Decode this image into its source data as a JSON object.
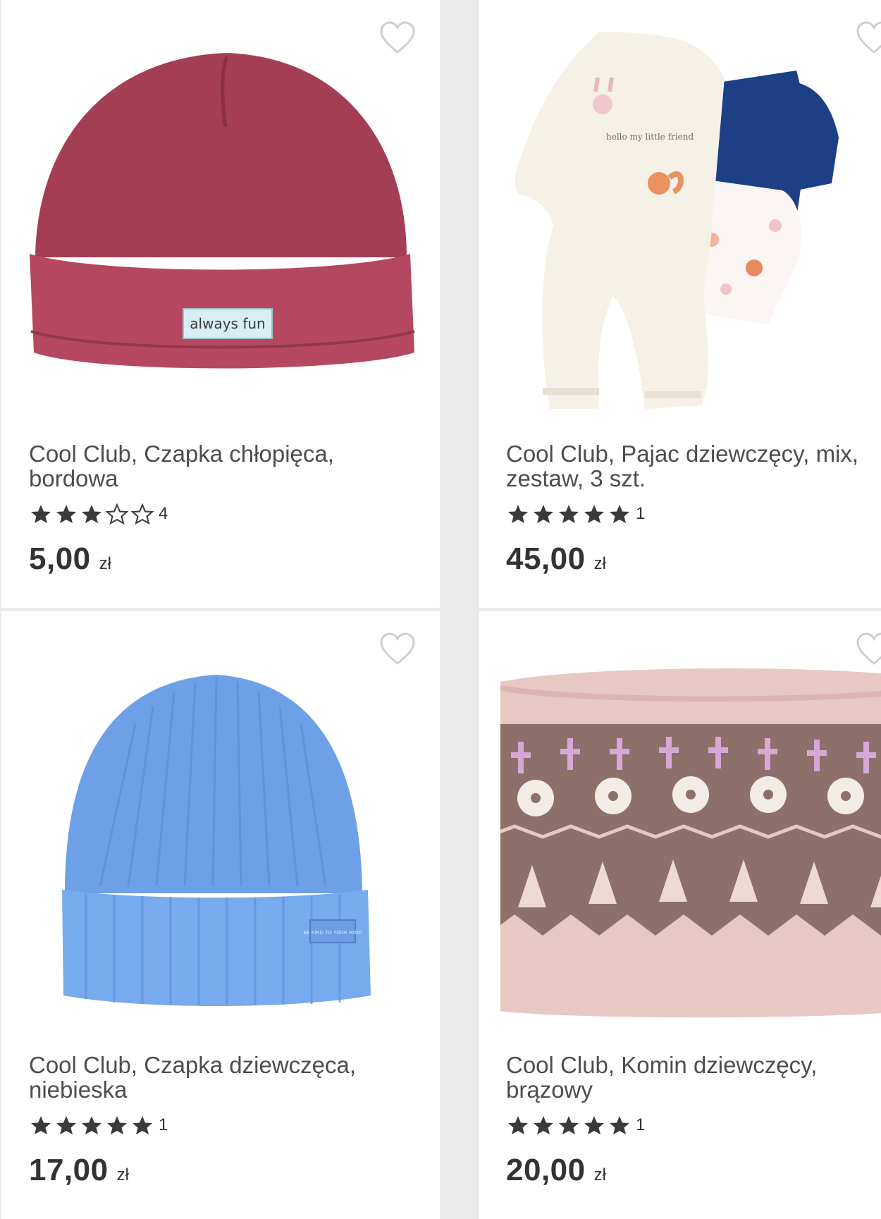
{
  "products": [
    {
      "title": "Cool Club, Czapka chłopięca, bordowa",
      "rating": 3,
      "rating_count": "4",
      "price": "5,00",
      "currency": "zł",
      "image_icon": "burgundy-beanie-product-image",
      "image_label": "always fun"
    },
    {
      "title": "Cool Club, Pajac dziewczęcy, mix, zestaw, 3 szt.",
      "rating": 5,
      "rating_count": "1",
      "price": "45,00",
      "currency": "zł",
      "image_icon": "baby-romper-set-product-image",
      "image_label": "hello my little friend"
    },
    {
      "title": "Cool Club, Czapka dziewczęca, niebieska",
      "rating": 5,
      "rating_count": "1",
      "price": "17,00",
      "currency": "zł",
      "image_icon": "blue-knit-beanie-product-image",
      "image_label": "BE KIND TO YOUR MIND"
    },
    {
      "title": "Cool Club, Komin dziewczęcy, brązowy",
      "rating": 5,
      "rating_count": "1",
      "price": "20,00",
      "currency": "zł",
      "image_icon": "fair-isle-snood-product-image"
    }
  ],
  "colors": {
    "star": "#3a3a3a",
    "star_empty_stroke": "#3a3a3a",
    "heart_stroke": "#cfcfcf",
    "text": "#4d4d4d",
    "price": "#333333"
  },
  "icons": {
    "wishlist": "heart-outline-icon",
    "star_filled": "star-filled-icon",
    "star_empty": "star-outline-icon"
  }
}
